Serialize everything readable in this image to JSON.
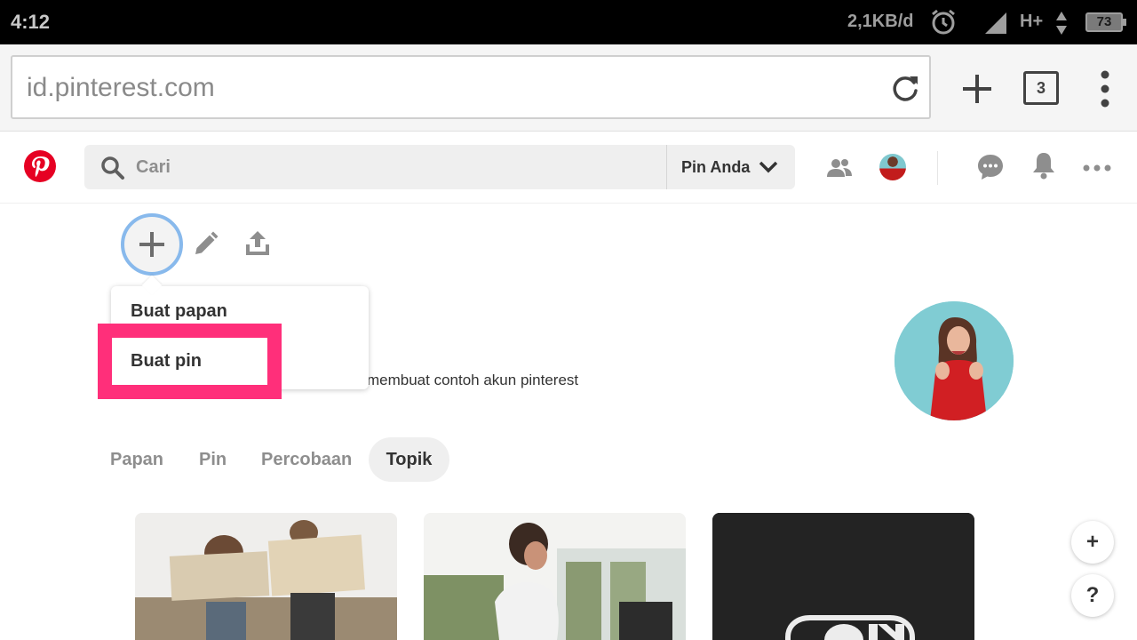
{
  "status_bar": {
    "time": "4:12",
    "network_speed": "2,1KB/d",
    "network_type": "H+",
    "battery": "73"
  },
  "browser": {
    "url": "id.pinterest.com",
    "tab_count": "3"
  },
  "header": {
    "search_placeholder": "Cari",
    "search_scope": "Pin Anda"
  },
  "profile": {
    "bio_visible": "membuat contoh akun pinterest",
    "bio_partial": "y",
    "create_menu": {
      "items": [
        {
          "label": "Buat papan"
        },
        {
          "label": "Buat pin"
        }
      ]
    }
  },
  "tabs": [
    {
      "label": "Papan",
      "active": false
    },
    {
      "label": "Pin",
      "active": false
    },
    {
      "label": "Percobaan",
      "active": false
    },
    {
      "label": "Topik",
      "active": true
    }
  ],
  "colors": {
    "pinterest_red": "#e60023",
    "highlight": "#ff2f7a",
    "focus_ring": "#88b9ec"
  },
  "icons": {
    "reload": "reload-icon",
    "new_tab": "plus-icon",
    "browser_menu": "kebab-menu-icon",
    "search": "search-icon",
    "friends": "people-icon",
    "messages": "chat-bubble-icon",
    "notifications": "bell-icon",
    "more": "ellipsis-icon",
    "create": "plus-icon",
    "edit": "pencil-icon",
    "share": "upload-icon",
    "fab_add": "plus-icon",
    "fab_help": "question-icon"
  },
  "fab": {
    "add_label": "+",
    "help_label": "?"
  }
}
